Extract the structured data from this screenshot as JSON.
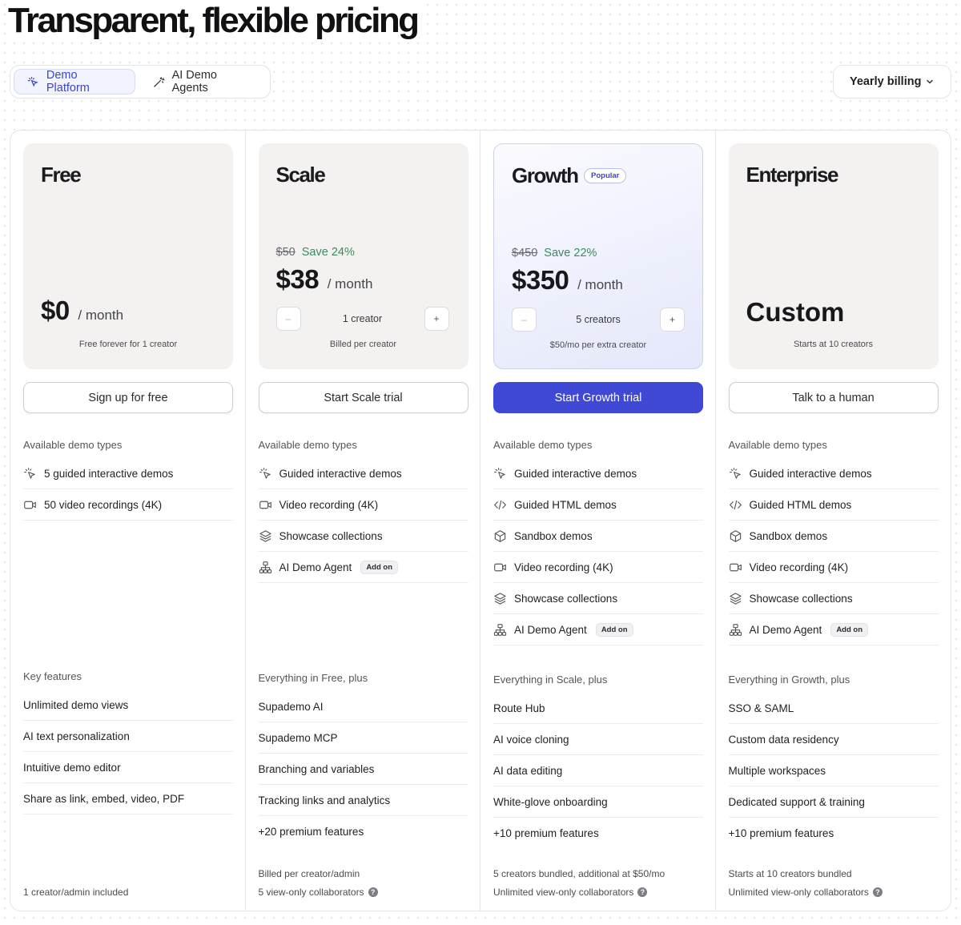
{
  "page": {
    "title": "Transparent, flexible pricing"
  },
  "tabs": [
    {
      "label": "Demo Platform",
      "icon": "cursor-click-icon",
      "active": true
    },
    {
      "label": "AI Demo Agents",
      "icon": "magic-wand-icon",
      "active": false
    }
  ],
  "billing": {
    "label": "Yearly billing"
  },
  "plans": [
    {
      "name": "Free",
      "price": "$0",
      "per": "/ month",
      "note": "Free forever for 1 creator",
      "cta": "Sign up for free",
      "types_label": "Available demo types",
      "types": [
        {
          "icon": "cursor-click-icon",
          "label": "5 guided interactive demos"
        },
        {
          "icon": "video-icon",
          "label": "50 video recordings (4K)"
        }
      ],
      "features_label": "Key features",
      "features": [
        "Unlimited demo views",
        "AI text personalization",
        "Intuitive demo editor",
        "Share as link, embed, video, PDF"
      ],
      "foot1": "",
      "foot2": "1 creator/admin included"
    },
    {
      "name": "Scale",
      "old_price": "$50",
      "save": "Save 24%",
      "price": "$38",
      "per": "/ month",
      "stepper": "1 creator",
      "note": "Billed per creator",
      "cta": "Start Scale trial",
      "types_label": "Available demo types",
      "types": [
        {
          "icon": "cursor-click-icon",
          "label": "Guided interactive demos"
        },
        {
          "icon": "video-icon",
          "label": "Video recording (4K)"
        },
        {
          "icon": "layers-icon",
          "label": "Showcase collections"
        },
        {
          "icon": "agent-network-icon",
          "label": "AI Demo Agent",
          "badge": "Add on"
        }
      ],
      "features_label": "Everything in Free, plus",
      "features": [
        "Supademo AI",
        "Supademo MCP",
        "Branching and variables",
        "Tracking links and analytics",
        "+20 premium features"
      ],
      "foot1": "Billed per creator/admin",
      "foot2": "5 view-only collaborators"
    },
    {
      "name": "Growth",
      "badge": "Popular",
      "old_price": "$450",
      "save": "Save 22%",
      "price": "$350",
      "per": "/ month",
      "stepper": "5 creators",
      "note": "$50/mo per extra creator",
      "cta": "Start Growth trial",
      "types_label": "Available demo types",
      "types": [
        {
          "icon": "cursor-click-icon",
          "label": "Guided interactive demos"
        },
        {
          "icon": "code-icon",
          "label": "Guided HTML demos"
        },
        {
          "icon": "cube-icon",
          "label": "Sandbox demos"
        },
        {
          "icon": "video-icon",
          "label": "Video recording (4K)"
        },
        {
          "icon": "layers-icon",
          "label": "Showcase collections"
        },
        {
          "icon": "agent-network-icon",
          "label": "AI Demo Agent",
          "badge": "Add on"
        }
      ],
      "features_label": "Everything in Scale, plus",
      "features": [
        "Route Hub",
        "AI voice cloning",
        "AI data editing",
        "White-glove onboarding",
        "+10 premium features"
      ],
      "foot1": "5 creators bundled, additional at $50/mo",
      "foot2": "Unlimited view-only collaborators"
    },
    {
      "name": "Enterprise",
      "custom": "Custom",
      "note": "Starts at 10 creators",
      "cta": "Talk to a human",
      "types_label": "Available demo types",
      "types": [
        {
          "icon": "cursor-click-icon",
          "label": "Guided interactive demos"
        },
        {
          "icon": "code-icon",
          "label": "Guided HTML demos"
        },
        {
          "icon": "cube-icon",
          "label": "Sandbox demos"
        },
        {
          "icon": "video-icon",
          "label": "Video recording (4K)"
        },
        {
          "icon": "layers-icon",
          "label": "Showcase collections"
        },
        {
          "icon": "agent-network-icon",
          "label": "AI Demo Agent",
          "badge": "Add on"
        }
      ],
      "features_label": "Everything in Growth, plus",
      "features": [
        "SSO & SAML",
        "Custom data residency",
        "Multiple workspaces",
        "Dedicated support & training",
        "+10 premium features"
      ],
      "foot1": "Starts at 10 creators bundled",
      "foot2": "Unlimited view-only collaborators"
    }
  ],
  "stepper_controls": {
    "minus": "–",
    "plus": "+"
  },
  "colors": {
    "accent": "#3f49d6",
    "save_green": "#3e8a5f",
    "popular": "#3b46c4"
  }
}
